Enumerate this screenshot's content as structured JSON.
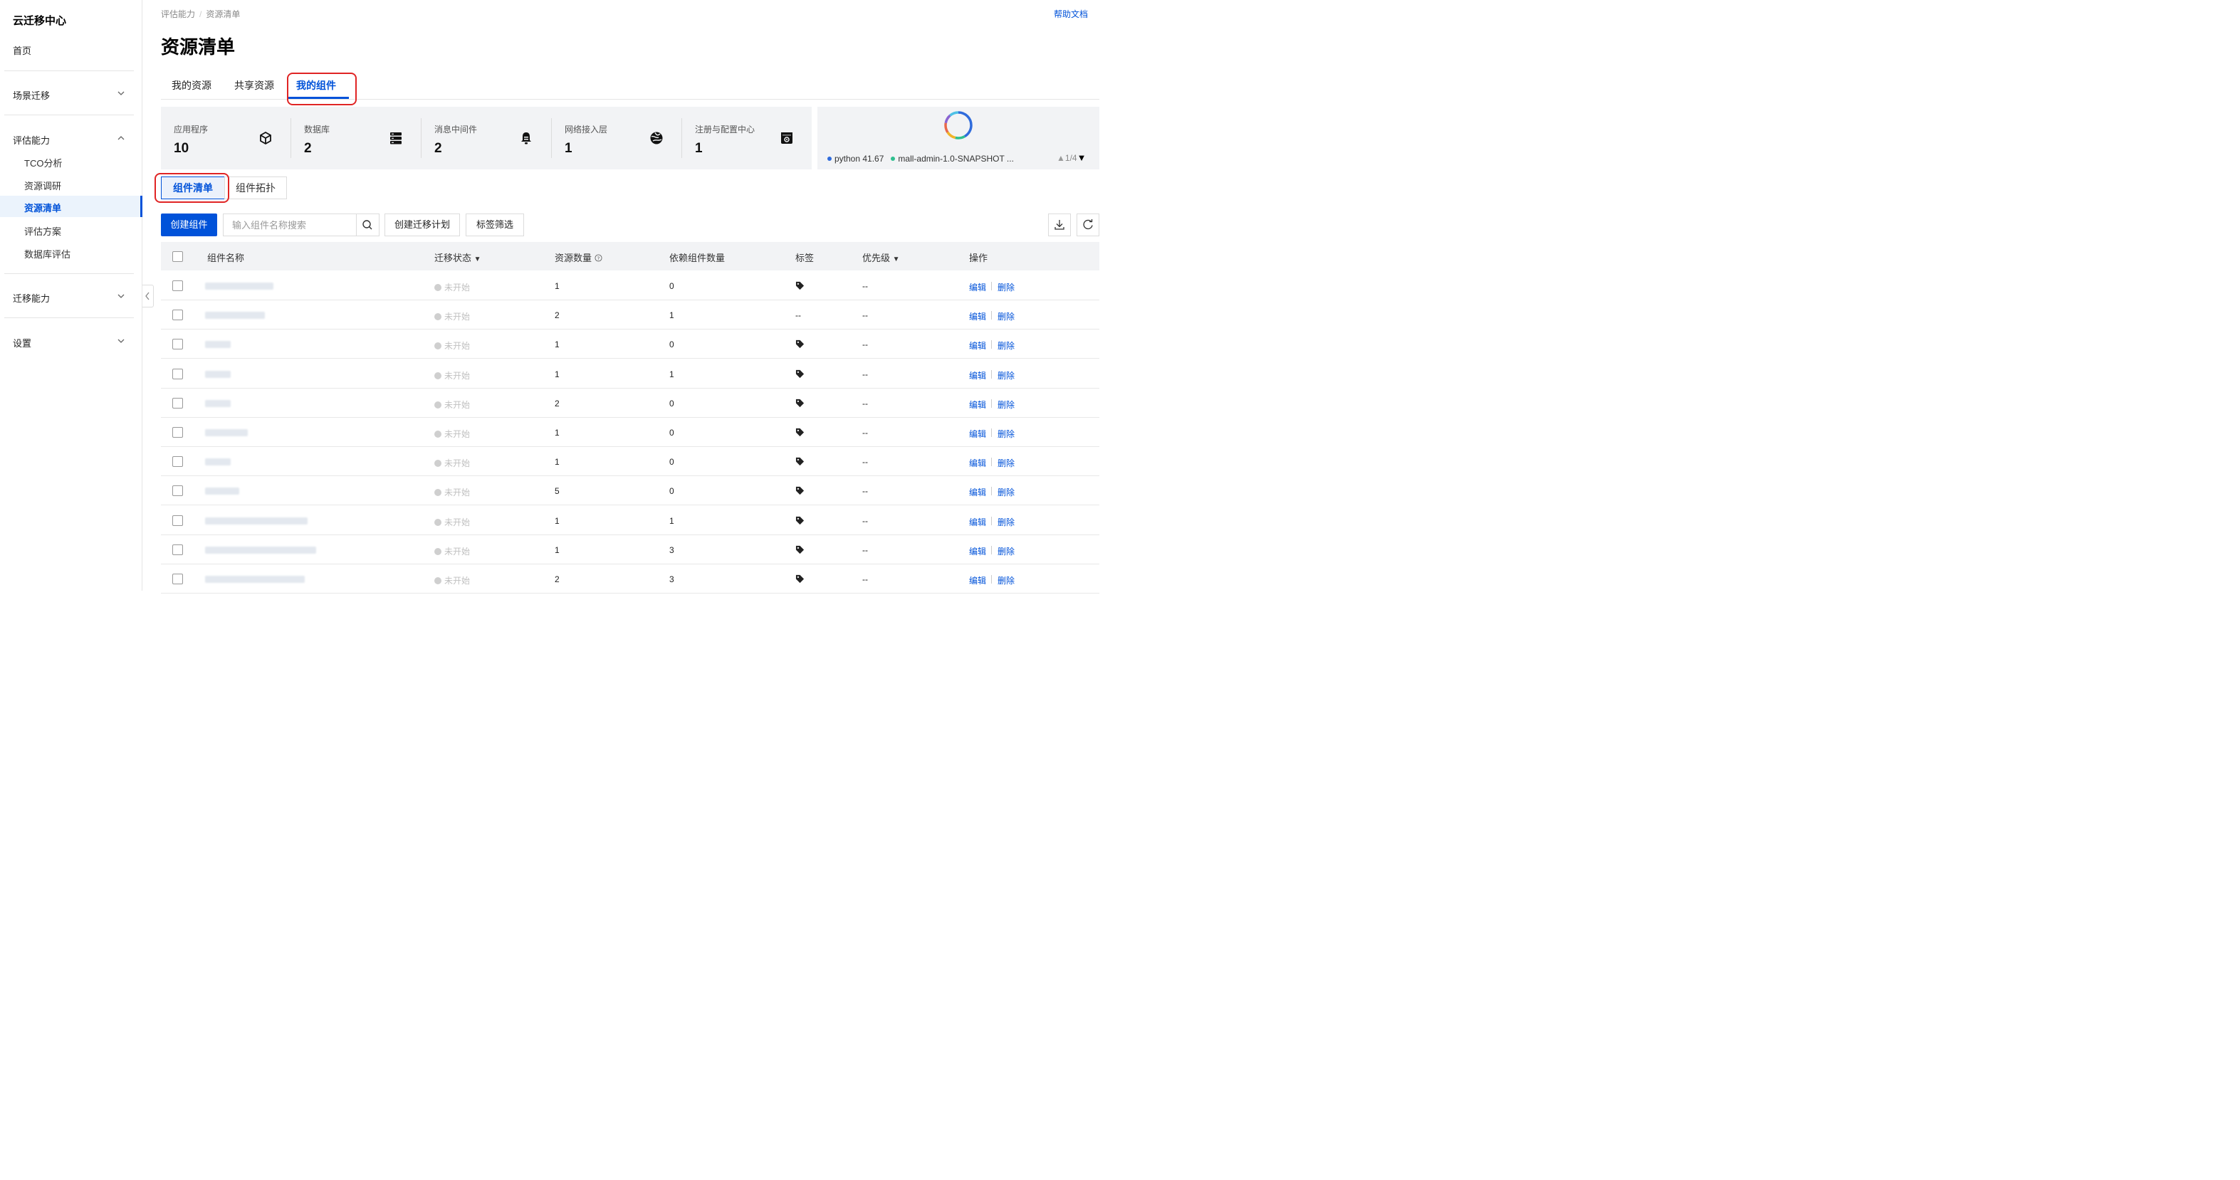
{
  "sidebar": {
    "title": "云迁移中心",
    "home": "首页",
    "groups": [
      {
        "label": "场景迁移"
      },
      {
        "label": "评估能力",
        "children": [
          "TCO分析",
          "资源调研",
          "资源清单",
          "评估方案",
          "数据库评估"
        ]
      },
      {
        "label": "迁移能力"
      },
      {
        "label": "设置"
      }
    ]
  },
  "breadcrumb": [
    "评估能力",
    "资源清单"
  ],
  "help_link": "帮助文档",
  "page_title": "资源清单",
  "tabs": [
    "我的资源",
    "共享资源",
    "我的组件"
  ],
  "stats": [
    {
      "label": "应用程序",
      "value": "10",
      "icon": "cube-icon"
    },
    {
      "label": "数据库",
      "value": "2",
      "icon": "database-icon"
    },
    {
      "label": "消息中间件",
      "value": "2",
      "icon": "bell-icon"
    },
    {
      "label": "网络接入层",
      "value": "1",
      "icon": "globe-icon"
    },
    {
      "label": "注册与配置中心",
      "value": "1",
      "icon": "config-box-icon"
    }
  ],
  "chart": {
    "legend": [
      {
        "label": "python",
        "value": "41.67",
        "color": "#2f6bdc"
      },
      {
        "label": "mall-admin-1.0-SNAPSHOT ...",
        "color": "#2fbf8f"
      }
    ],
    "pager": "1/4",
    "donut_colors": [
      "#2f6bdc",
      "#2fbf8f",
      "#f0b429",
      "#e8684a",
      "#8a63d2",
      "#4ec1e6"
    ]
  },
  "subtabs": [
    "组件清单",
    "组件拓扑"
  ],
  "toolbar": {
    "create_label": "创建组件",
    "search_placeholder": "输入组件名称搜索",
    "migration_plan_label": "创建迁移计划",
    "tag_filter_label": "标签筛选"
  },
  "table": {
    "headers": [
      "组件名称",
      "迁移状态",
      "资源数量",
      "依赖组件数量",
      "标签",
      "优先级",
      "操作"
    ],
    "edit_label": "编辑",
    "delete_label": "删除",
    "rows": [
      {
        "status": "未开始",
        "resources": "1",
        "deps": "0",
        "tag": "icon",
        "priority": "--"
      },
      {
        "status": "未开始",
        "resources": "2",
        "deps": "1",
        "tag": "--",
        "priority": "--"
      },
      {
        "status": "未开始",
        "resources": "1",
        "deps": "0",
        "tag": "icon",
        "priority": "--"
      },
      {
        "status": "未开始",
        "resources": "1",
        "deps": "1",
        "tag": "icon",
        "priority": "--"
      },
      {
        "status": "未开始",
        "resources": "2",
        "deps": "0",
        "tag": "icon",
        "priority": "--"
      },
      {
        "status": "未开始",
        "resources": "1",
        "deps": "0",
        "tag": "icon",
        "priority": "--"
      },
      {
        "status": "未开始",
        "resources": "1",
        "deps": "0",
        "tag": "icon",
        "priority": "--"
      },
      {
        "status": "未开始",
        "resources": "5",
        "deps": "0",
        "tag": "icon",
        "priority": "--"
      },
      {
        "status": "未开始",
        "resources": "1",
        "deps": "1",
        "tag": "icon",
        "priority": "--"
      },
      {
        "status": "未开始",
        "resources": "1",
        "deps": "3",
        "tag": "icon",
        "priority": "--"
      },
      {
        "status": "未开始",
        "resources": "2",
        "deps": "3",
        "tag": "icon",
        "priority": "--"
      }
    ]
  }
}
